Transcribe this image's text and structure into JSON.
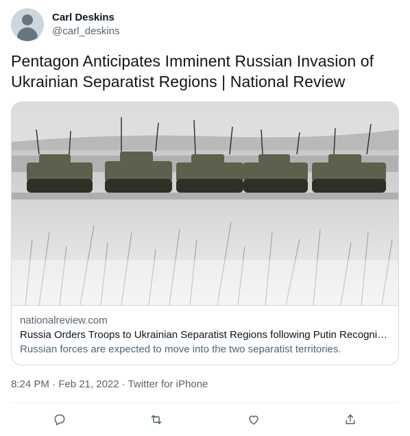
{
  "user": {
    "display_name": "Carl Deskins",
    "handle": "@carl_deskins",
    "avatar_icon": "default-profile-icon"
  },
  "tweet": {
    "text": "Pentagon Anticipates Imminent Russian Invasion of Ukrainian Separatist Regions | National Review"
  },
  "card": {
    "domain": "nationalreview.com",
    "title": "Russia Orders Troops to Ukrainian Separatist Regions following Putin Recogniti...",
    "description": "Russian forces are expected to move into the two separatist territories."
  },
  "meta": {
    "timestamp": "8:24 PM · Feb 21, 2022 · Twitter for iPhone"
  },
  "actions": {
    "reply_icon": "reply-icon",
    "retweet_icon": "retweet-icon",
    "like_icon": "like-icon",
    "share_icon": "share-icon"
  },
  "colors": {
    "text": "#0f1419",
    "secondary": "#536471",
    "border": "#cfd9de"
  }
}
